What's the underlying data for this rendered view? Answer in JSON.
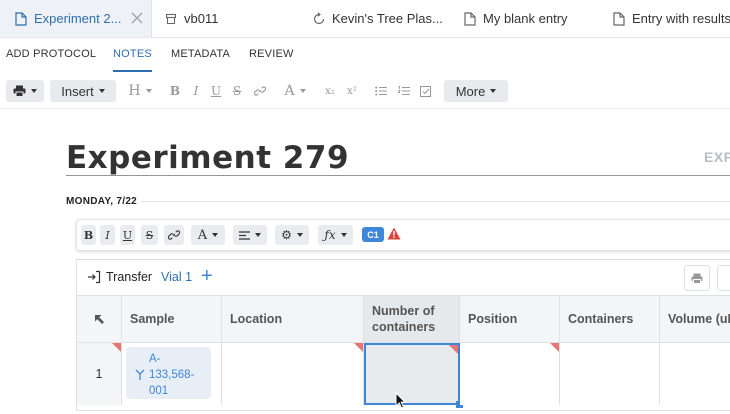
{
  "tabs": [
    {
      "label": "Experiment 2...",
      "icon": "document-icon",
      "active": true
    },
    {
      "label": "vb011",
      "icon": "box-icon",
      "active": false
    },
    {
      "label": "Kevin's Tree Plas...",
      "icon": "sync-icon",
      "active": false
    },
    {
      "label": "My blank entry",
      "icon": "document-icon",
      "active": false
    },
    {
      "label": "Entry with results",
      "icon": "document-icon",
      "active": false
    }
  ],
  "subnav": [
    "ADD PROTOCOL",
    "NOTES",
    "METADATA",
    "REVIEW"
  ],
  "toolbar": {
    "insert_label": "Insert",
    "heading_label": "H",
    "bold": "B",
    "italic": "I",
    "underline": "U",
    "strike": "S",
    "font_color": "A",
    "subscript": "x₂",
    "superscript": "x²",
    "more_label": "More"
  },
  "doc": {
    "title": "Experiment 279",
    "right_label": "EXP",
    "date": "MONDAY, 7/22"
  },
  "entity_toolbar": {
    "bold": "B",
    "italic": "I",
    "underline": "U",
    "strike": "S",
    "font_color": "A",
    "fx": "ƒx",
    "badge": "C1"
  },
  "table": {
    "title": "Transfer",
    "subtitle": "Vial 1",
    "add": "+",
    "columns": [
      "Sample",
      "Location",
      "Number of containers",
      "Position",
      "Containers",
      "Volume (uL"
    ],
    "rows": [
      {
        "index": "1",
        "sample_lines": [
          "A-",
          "133,568-",
          "001"
        ]
      }
    ]
  },
  "colors": {
    "accent": "#2f6fb0",
    "badge": "#3f86d8",
    "warning": "#d9453d",
    "marker": "#e87474"
  }
}
